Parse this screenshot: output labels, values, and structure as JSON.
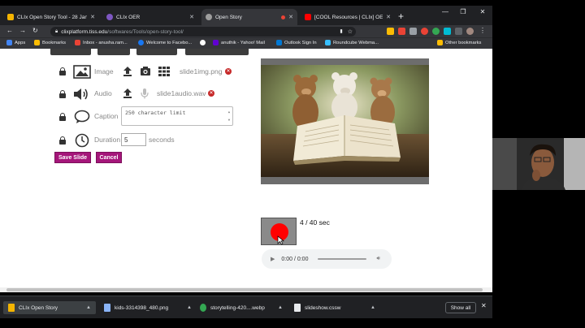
{
  "tabs": [
    {
      "title": "CLIx Open Story Tool - 28 Jan 20",
      "favicon_color": "#f4b400",
      "active": false
    },
    {
      "title": "CLIx OER",
      "favicon_color": "#7e57c2",
      "active": false
    },
    {
      "title": "Open Story",
      "favicon_color": "#9e9e9e",
      "active": true
    },
    {
      "title": "[COOL Resources | CLIx] OERs] L",
      "favicon_color": "#ff0000",
      "active": false
    }
  ],
  "address": {
    "host": "clixplatform.tiss.edu",
    "path": "/softwares/Tools/open-story-tool/"
  },
  "bookmarks": [
    {
      "label": "Apps",
      "icon_color": "#4285f4"
    },
    {
      "label": "Bookmarks",
      "icon_color": "#fbbc04"
    },
    {
      "label": "Inbox - anusha.ram...",
      "icon_color": "#ea4335"
    },
    {
      "label": "Welcome to Facebo...",
      "icon_color": "#1877f2"
    },
    {
      "label": "",
      "icon_color": "#ffffff"
    },
    {
      "label": "anuthik - Yahoo! Mail",
      "icon_color": "#6001d2"
    },
    {
      "label": "Outlook Sign In",
      "icon_color": "#0078d4"
    },
    {
      "label": "Roundcube Webma...",
      "icon_color": "#37beff"
    }
  ],
  "other_bookmarks": "Other bookmarks",
  "editor": {
    "image": {
      "label": "Image",
      "filename": "slide1img.png"
    },
    "audio": {
      "label": "Audio",
      "filename": "slide1audio.wav"
    },
    "caption": {
      "label": "Caption",
      "placeholder": "250 character limit"
    },
    "duration": {
      "label": "Duration",
      "value": "5",
      "unit": "seconds"
    },
    "save_label": "Save Slide",
    "cancel_label": "Cancel"
  },
  "recorder": {
    "time_text": "4 / 40 sec",
    "player_time": "0:00 / 0:00"
  },
  "downloads": [
    {
      "name": "CLIx Open Story",
      "icon_color": "#f4b400"
    },
    {
      "name": "kids-3314398_480.png",
      "icon_color": "#8ab4f8"
    },
    {
      "name": "storytelling-420....webp",
      "icon_color": "#34a853"
    },
    {
      "name": "slideshow.cssw",
      "icon_color": "#e8eaed"
    }
  ],
  "show_all": "Show all",
  "colors": {
    "accent_button": "#a5167a",
    "record_red": "#ff0000",
    "remove_red": "#c62828"
  }
}
